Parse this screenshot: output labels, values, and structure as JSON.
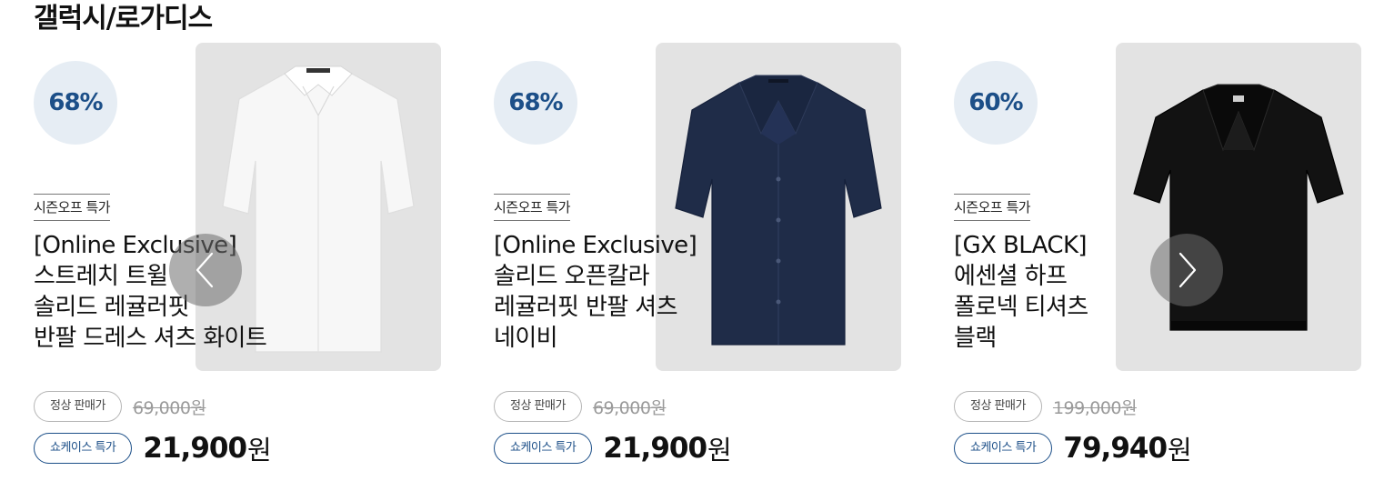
{
  "section": {
    "title": "갤럭시/로가디스"
  },
  "carousel": {
    "prev_icon": "chevron-left-icon",
    "next_icon": "chevron-right-icon"
  },
  "products": [
    {
      "discount": "68%",
      "promo_tag": "시즌오프 특가",
      "name_lines": [
        "[Online Exclusive]",
        "스트레치 트윌",
        "솔리드 레귤러핏",
        "반팔 드레스 셔츠 화이트"
      ],
      "regular_label": "정상 판매가",
      "original_price": "69,000원",
      "sale_label": "쇼케이스 특가",
      "sale_price": "21,900",
      "sale_unit": "원",
      "image_color": "#f7f7f7",
      "image_type": "dress-shirt"
    },
    {
      "discount": "68%",
      "promo_tag": "시즌오프 특가",
      "name_lines": [
        "[Online Exclusive]",
        "솔리드 오픈칼라",
        "레귤러핏 반팔 셔츠",
        "네이비"
      ],
      "regular_label": "정상 판매가",
      "original_price": "69,000원",
      "sale_label": "쇼케이스 특가",
      "sale_price": "21,900",
      "sale_unit": "원",
      "image_color": "#1f2c48",
      "image_type": "open-collar-shirt"
    },
    {
      "discount": "60%",
      "promo_tag": "시즌오프 특가",
      "name_lines": [
        "[GX BLACK]",
        "에센셜 하프",
        "폴로넥 티셔츠",
        "블랙"
      ],
      "regular_label": "정상 판매가",
      "original_price": "199,000원",
      "sale_label": "쇼케이스 특가",
      "sale_price": "79,940",
      "sale_unit": "원",
      "image_color": "#121212",
      "image_type": "polo-shirt"
    }
  ],
  "colors": {
    "accent": "#1c4f88",
    "badge_bg": "#e6edf4",
    "image_bg": "#e3e3e3"
  }
}
